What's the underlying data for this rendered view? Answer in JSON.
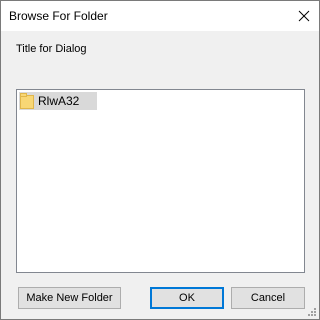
{
  "window": {
    "title": "Browse For Folder",
    "close_icon": "close-icon"
  },
  "dialog": {
    "prompt": "Title for Dialog"
  },
  "tree": {
    "items": [
      {
        "label": "RlwA32",
        "icon": "folder-icon",
        "selected": true
      }
    ]
  },
  "buttons": {
    "make_new_folder": "Make New Folder",
    "ok": "OK",
    "cancel": "Cancel"
  },
  "colors": {
    "accent": "#0078d7",
    "folder": "#f8d775",
    "selection": "#d9d9d9"
  }
}
